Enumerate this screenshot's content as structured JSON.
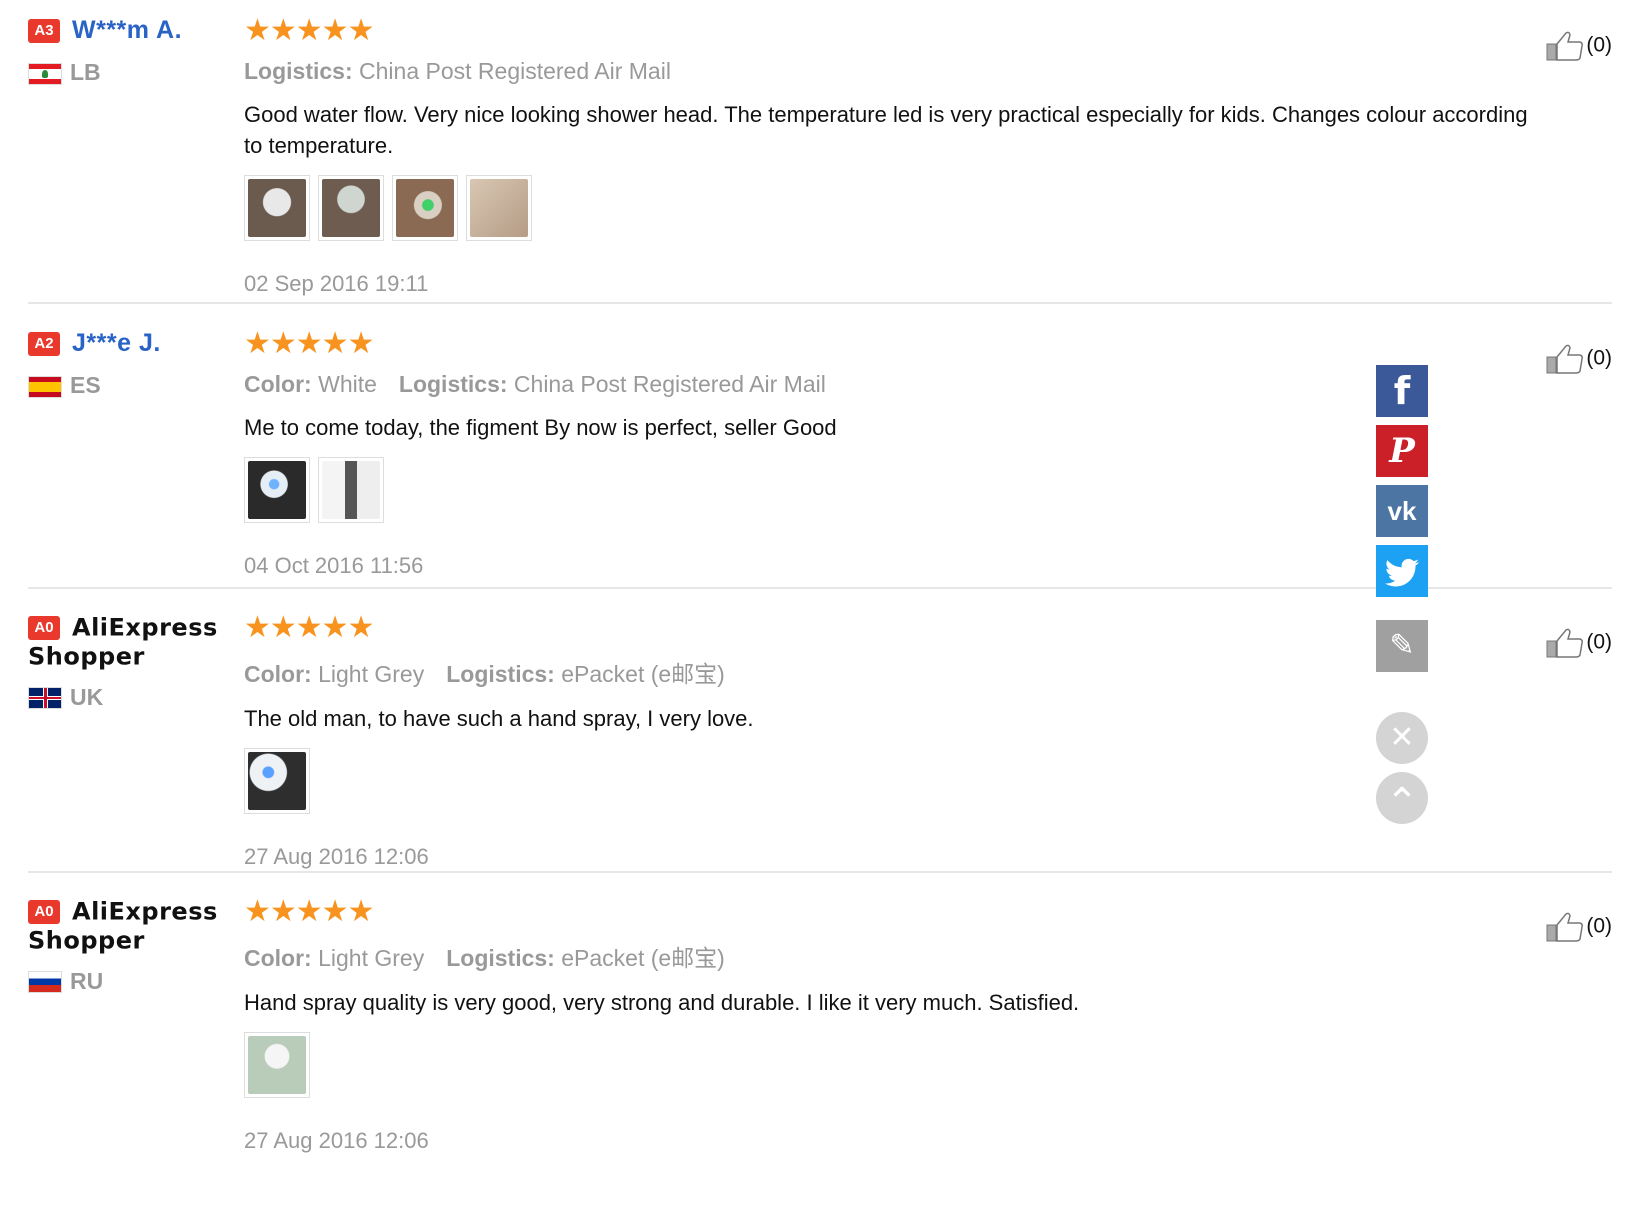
{
  "reviews": [
    {
      "level": "A3",
      "name": "W***m A.",
      "country": "LB",
      "stars": "★★★★★",
      "color_label": "",
      "color_value": "",
      "logistics_label": "Logistics:",
      "logistics_value": "China Post Registered Air Mail",
      "text": "Good water flow. Very nice looking shower head. The temperature led is very practical especially for kids. Changes colour according to temperature.",
      "date": "02 Sep 2016 19:11",
      "likes": "(0)"
    },
    {
      "level": "A2",
      "name": "J***e J.",
      "country": "ES",
      "stars": "★★★★★",
      "color_label": "Color:",
      "color_value": "White",
      "logistics_label": "Logistics:",
      "logistics_value": "China Post Registered Air Mail",
      "text": "Me to come today, the figment By now is perfect, seller Good",
      "date": "04 Oct 2016 11:56",
      "likes": "(0)"
    },
    {
      "level": "A0",
      "name": "AliExpress Shopper",
      "country": "UK",
      "stars": "★★★★★",
      "color_label": "Color:",
      "color_value": "Light Grey",
      "logistics_label": "Logistics:",
      "logistics_value": "ePacket (e邮宝)",
      "text": "The old man, to have such a hand spray, I very love.",
      "date": "27 Aug 2016 12:06",
      "likes": "(0)"
    },
    {
      "level": "A0",
      "name": "AliExpress Shopper",
      "country": "RU",
      "stars": "★★★★★",
      "color_label": "Color:",
      "color_value": "Light Grey",
      "logistics_label": "Logistics:",
      "logistics_value": "ePacket (e邮宝)",
      "text": "Hand spray quality is very good, very strong and durable. I like it very much. Satisfied.",
      "date": "27 Aug 2016 12:06",
      "likes": "(0)"
    }
  ],
  "share": {
    "facebook_glyph": "f",
    "pinterest_glyph": "P",
    "vk_glyph": "vk",
    "twitter_glyph": "t",
    "edit_glyph": "✎",
    "close_glyph": "✕",
    "top_glyph": "⌃"
  },
  "colors": {
    "facebook": "#3b5998",
    "pinterest": "#cb2027",
    "vk": "#4c75a3",
    "twitter": "#1da1f2",
    "edit": "#a0a0a0",
    "star": "#f7931e",
    "level_badge": "#e8392c",
    "name_link": "#2a63c6"
  }
}
